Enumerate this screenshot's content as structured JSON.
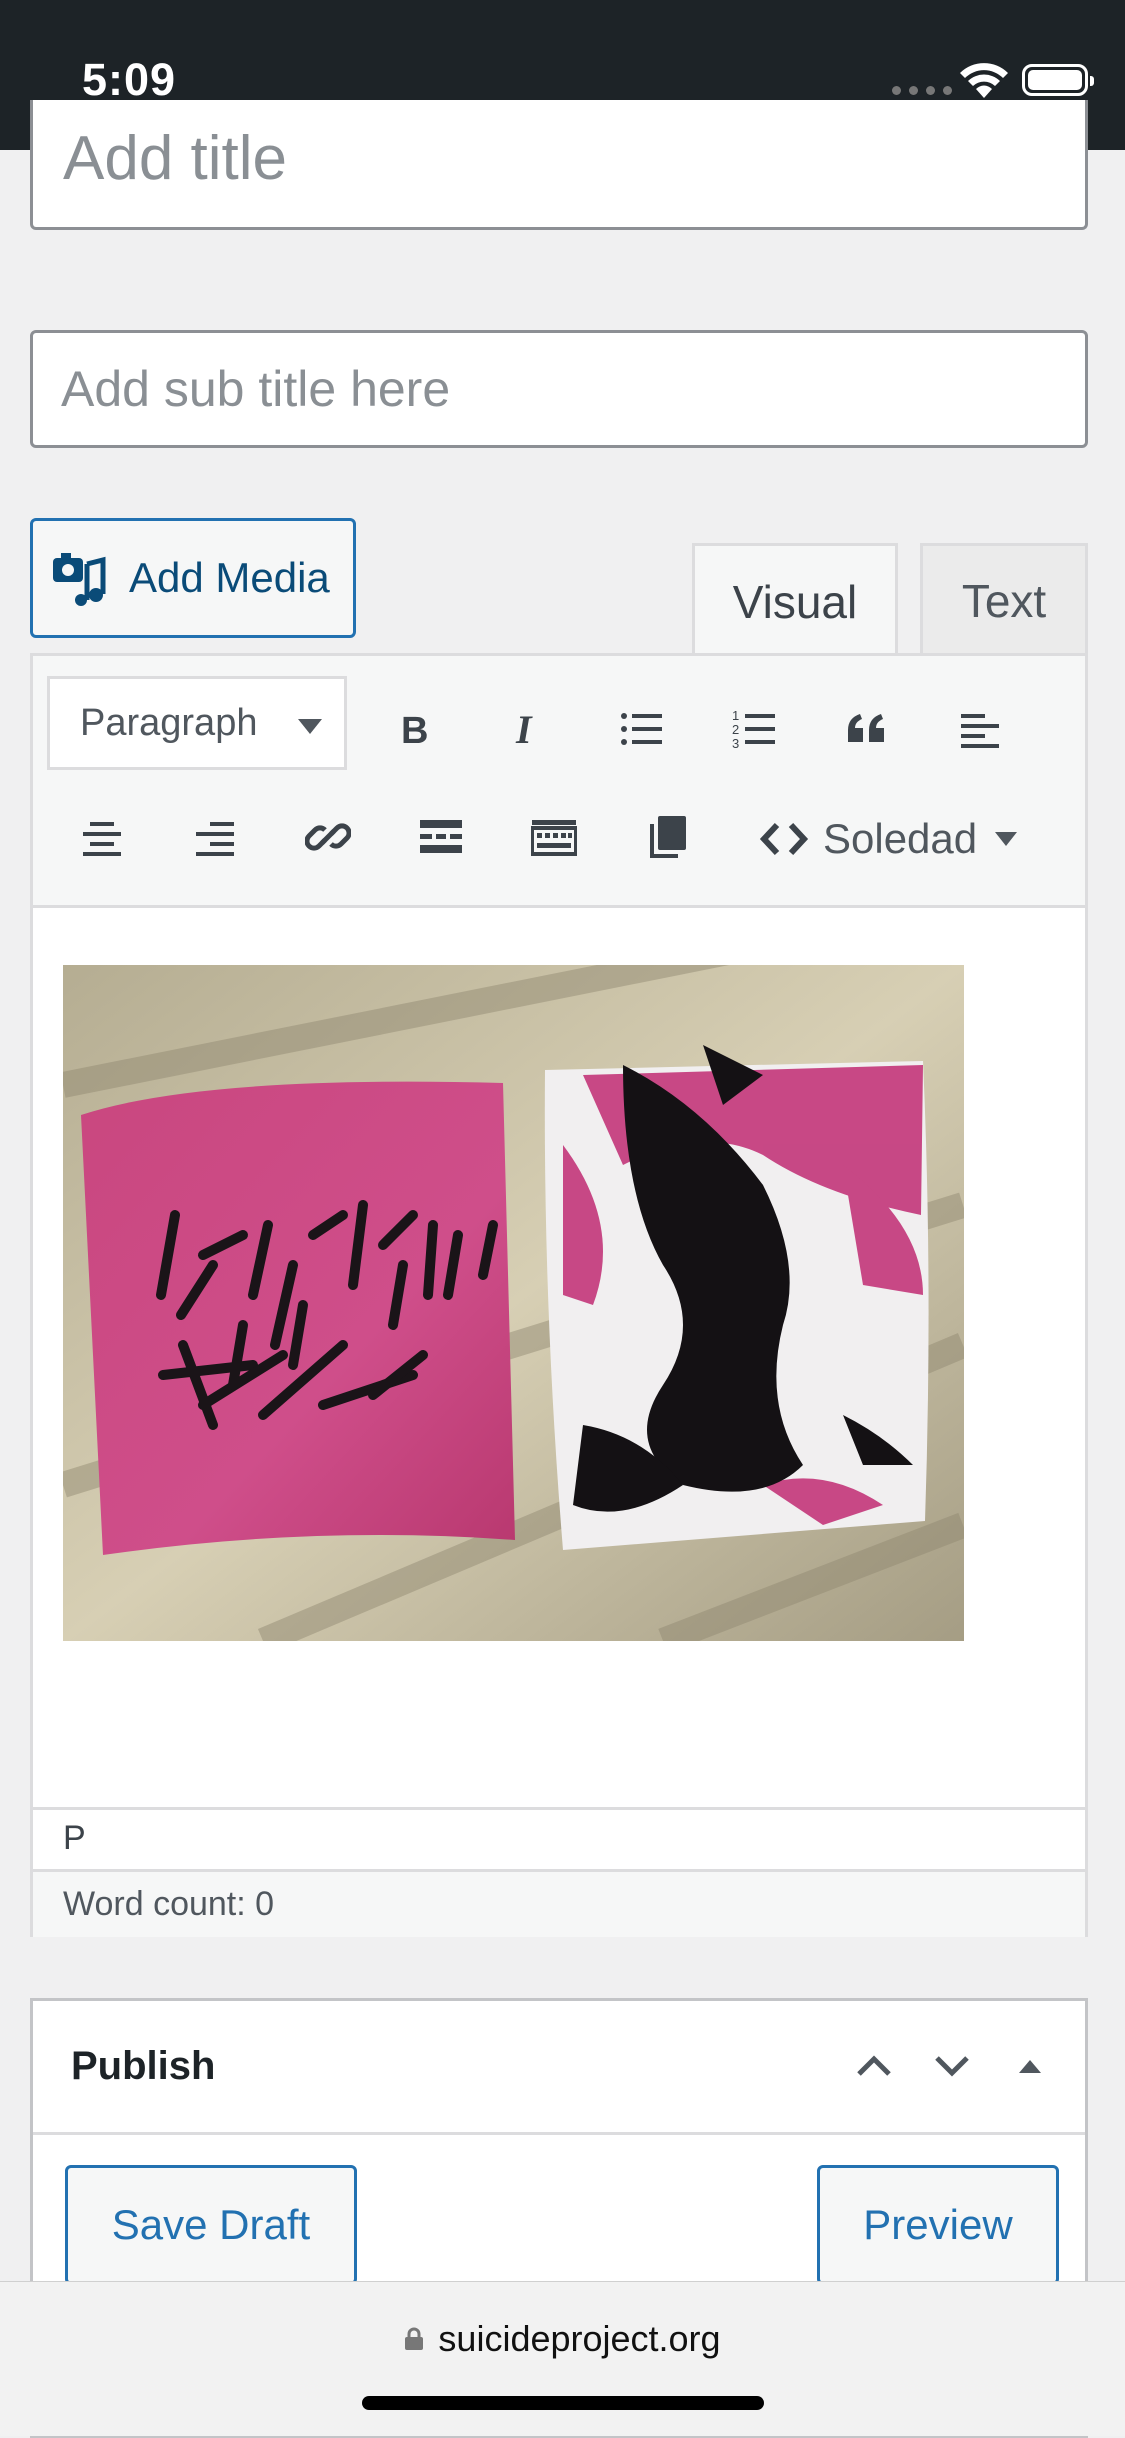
{
  "status_bar": {
    "time": "5:09"
  },
  "title_field": {
    "placeholder": "Add title"
  },
  "subtitle_field": {
    "placeholder": "Add sub title here"
  },
  "add_media": {
    "label": "Add Media"
  },
  "editor_tabs": [
    {
      "label": "Visual",
      "active": true
    },
    {
      "label": "Text",
      "active": false
    }
  ],
  "toolbar": {
    "format_select": "Paragraph",
    "font_select": "Soledad",
    "icons": [
      "bold-icon",
      "italic-icon",
      "bullet-list-icon",
      "numbered-list-icon",
      "blockquote-icon",
      "align-left-icon",
      "align-center-icon",
      "align-right-icon",
      "link-icon",
      "read-more-icon",
      "keyboard-icon",
      "copy-icon",
      "code-icon"
    ]
  },
  "editor": {
    "path": "P",
    "word_count": "Word count: 0"
  },
  "publish": {
    "title": "Publish",
    "save_draft": "Save Draft",
    "preview": "Preview"
  },
  "browser": {
    "url": "suicideproject.org"
  },
  "colors": {
    "accent": "#2271b1",
    "status_bar": "#1d2327",
    "pink": "#c43a7c"
  }
}
